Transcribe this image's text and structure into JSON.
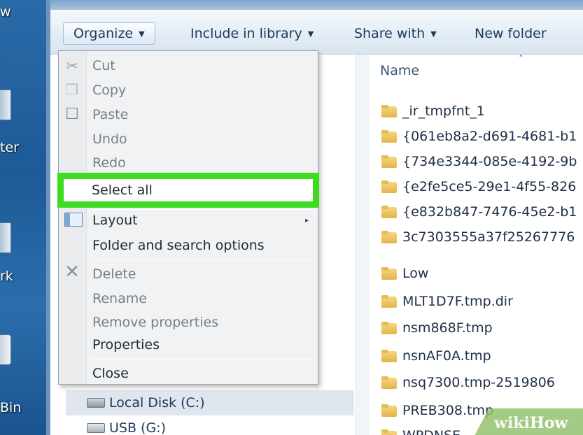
{
  "desktop": {
    "labels": [
      "w",
      "ter",
      "rk",
      "Bin"
    ]
  },
  "toolbar": {
    "organize": "Organize",
    "include": "Include in library",
    "share": "Share with",
    "new_folder": "New folder"
  },
  "menu": {
    "items": [
      {
        "label": "Cut",
        "enabled": false,
        "icon": "scissors-icon"
      },
      {
        "label": "Copy",
        "enabled": false,
        "icon": "copy-icon"
      },
      {
        "label": "Paste",
        "enabled": false,
        "icon": "paste-icon"
      },
      {
        "label": "Undo",
        "enabled": false
      },
      {
        "label": "Redo",
        "enabled": false
      },
      {
        "label": "Select all",
        "enabled": true,
        "highlighted": true
      },
      {
        "label": "Layout",
        "enabled": true,
        "icon": "layout-icon",
        "submenu": true
      },
      {
        "label": "Folder and search options",
        "enabled": true
      },
      {
        "label": "Delete",
        "enabled": false,
        "icon": "delete-x-icon"
      },
      {
        "label": "Rename",
        "enabled": false
      },
      {
        "label": "Remove properties",
        "enabled": false
      },
      {
        "label": "Properties",
        "enabled": true
      },
      {
        "label": "Close",
        "enabled": true
      }
    ],
    "highlight_color": "#3ddc20"
  },
  "nav": {
    "items": [
      {
        "label": "Local Disk (C:)",
        "icon": "local-disk-icon",
        "selected": true
      },
      {
        "label": "USB (G:)",
        "icon": "usb-drive-icon",
        "selected": false
      }
    ]
  },
  "files": {
    "column": "Name",
    "items": [
      "_ir_tmpfnt_1",
      "{061eb8a2-d691-4681-b1",
      "{734e3344-085e-4192-9b",
      "{e2fe5ce5-29e1-4f55-826",
      "{e832b847-7476-45e2-b1",
      "3c7303555a37f25267776",
      "Low",
      "MLT1D7F.tmp.dir",
      "nsm868F.tmp",
      "nsnAF0A.tmp",
      "nsq7300.tmp-2519806",
      "PREB308.tmp",
      "WPDNSE"
    ]
  },
  "watermark": {
    "wiki": "wiki",
    "how": "How"
  }
}
